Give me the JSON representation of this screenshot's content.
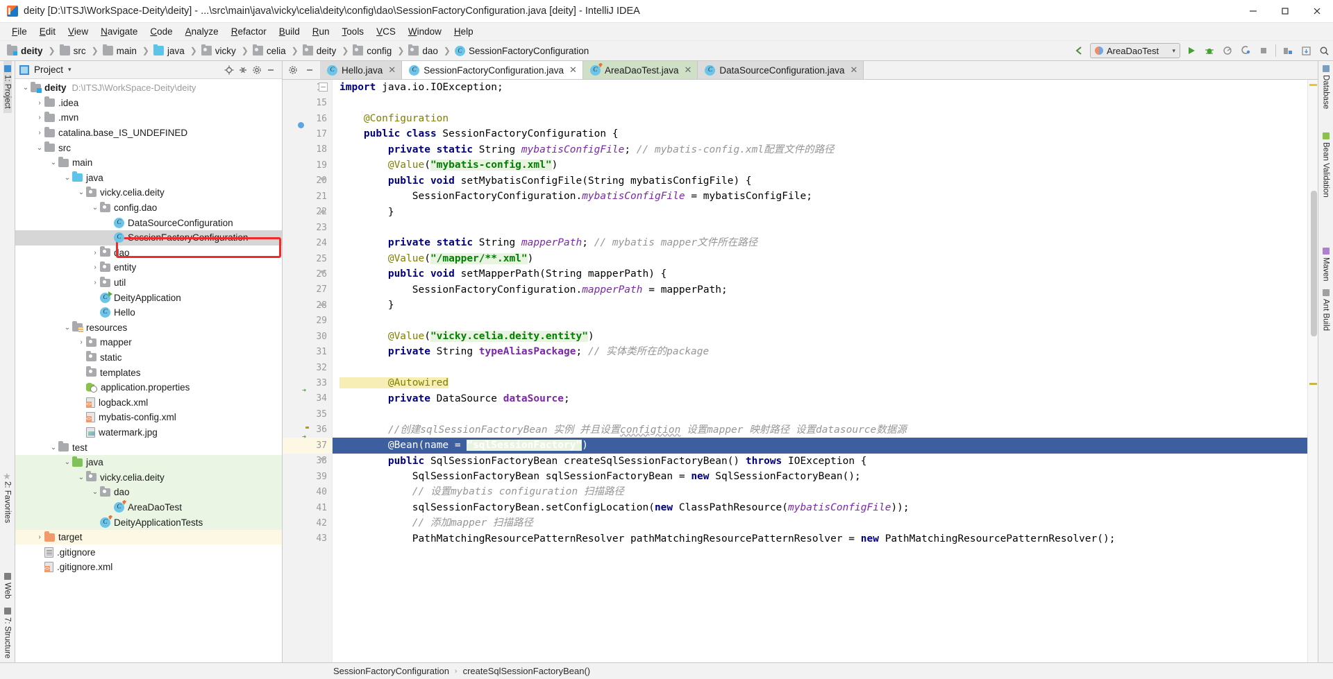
{
  "window": {
    "title": "deity [D:\\ITSJ\\WorkSpace-Deity\\deity] - ...\\src\\main\\java\\vicky\\celia\\deity\\config\\dao\\SessionFactoryConfiguration.java [deity] - IntelliJ IDEA",
    "minimize": "–",
    "maximize": "❐",
    "close": "✕"
  },
  "menubar": {
    "items": [
      "File",
      "Edit",
      "View",
      "Navigate",
      "Code",
      "Analyze",
      "Refactor",
      "Build",
      "Run",
      "Tools",
      "VCS",
      "Window",
      "Help"
    ]
  },
  "breadcrumb": [
    {
      "label": "deity",
      "icon": "module-folder-icon",
      "bold": true
    },
    {
      "label": "src",
      "icon": "folder-icon",
      "bold": false
    },
    {
      "label": "main",
      "icon": "folder-icon",
      "bold": false
    },
    {
      "label": "java",
      "icon": "source-folder-icon",
      "bold": false
    },
    {
      "label": "vicky",
      "icon": "package-icon",
      "bold": false
    },
    {
      "label": "celia",
      "icon": "package-icon",
      "bold": false
    },
    {
      "label": "deity",
      "icon": "package-icon",
      "bold": false
    },
    {
      "label": "config",
      "icon": "package-icon",
      "bold": false
    },
    {
      "label": "dao",
      "icon": "package-icon",
      "bold": false
    },
    {
      "label": "SessionFactoryConfiguration",
      "icon": "class-icon",
      "bold": false
    }
  ],
  "toolbar": {
    "back_arrow": "back-arrow-icon",
    "run_config": "AreaDaoTest",
    "run": "run-icon",
    "debug": "debug-icon",
    "coverage": "run-with-coverage-icon",
    "profile": "profiler-icon",
    "stop": "stop-icon",
    "project_structure": "project-structure-icon",
    "update": "update-icon",
    "search": "search-everywhere-icon"
  },
  "left_rail": [
    {
      "label": "1: Project",
      "icon": "project-icon",
      "selected": true
    },
    {
      "label": "2: Favorites",
      "icon": "star-icon",
      "selected": false
    },
    {
      "label": "Web",
      "icon": "web-icon",
      "selected": false
    },
    {
      "label": "7: Structure",
      "icon": "structure-icon",
      "selected": false
    }
  ],
  "right_rail": [
    {
      "label": "Database",
      "icon": "database-icon"
    },
    {
      "label": "Bean Validation",
      "icon": "bean-validation-icon"
    },
    {
      "label": "Maven",
      "icon": "maven-icon"
    },
    {
      "label": "Ant Build",
      "icon": "ant-build-icon"
    }
  ],
  "project_panel": {
    "title": "Project",
    "caret": "▾",
    "actions": [
      "locate-icon",
      "collapse-all-icon",
      "settings-icon",
      "hide-icon"
    ],
    "tree": [
      {
        "indent": 0,
        "arrow": "▾",
        "icon": "module-folder-icon",
        "name": "deity",
        "bold": true,
        "location": "D:\\ITSJ\\WorkSpace-Deity\\deity",
        "state": ""
      },
      {
        "indent": 1,
        "arrow": "›",
        "icon": "folder-icon",
        "name": ".idea",
        "bold": false,
        "location": "",
        "state": ""
      },
      {
        "indent": 1,
        "arrow": "›",
        "icon": "folder-icon",
        "name": ".mvn",
        "bold": false,
        "location": "",
        "state": ""
      },
      {
        "indent": 1,
        "arrow": "›",
        "icon": "folder-icon",
        "name": "catalina.base_IS_UNDEFINED",
        "bold": false,
        "location": "",
        "state": ""
      },
      {
        "indent": 1,
        "arrow": "▾",
        "icon": "folder-icon",
        "name": "src",
        "bold": false,
        "location": "",
        "state": ""
      },
      {
        "indent": 2,
        "arrow": "▾",
        "icon": "folder-icon",
        "name": "main",
        "bold": false,
        "location": "",
        "state": ""
      },
      {
        "indent": 3,
        "arrow": "▾",
        "icon": "source-folder-icon",
        "name": "java",
        "bold": false,
        "location": "",
        "state": ""
      },
      {
        "indent": 4,
        "arrow": "▾",
        "icon": "package-icon",
        "name": "vicky.celia.deity",
        "bold": false,
        "location": "",
        "state": ""
      },
      {
        "indent": 5,
        "arrow": "▾",
        "icon": "package-icon",
        "name": "config.dao",
        "bold": false,
        "location": "",
        "state": ""
      },
      {
        "indent": 6,
        "arrow": "",
        "icon": "class-icon",
        "name": "DataSourceConfiguration",
        "bold": false,
        "location": "",
        "state": ""
      },
      {
        "indent": 6,
        "arrow": "",
        "icon": "class-icon",
        "name": "SessionFactoryConfiguration",
        "bold": false,
        "location": "",
        "state": "selected"
      },
      {
        "indent": 5,
        "arrow": "›",
        "icon": "package-icon",
        "name": "dao",
        "bold": false,
        "location": "",
        "state": ""
      },
      {
        "indent": 5,
        "arrow": "›",
        "icon": "package-icon",
        "name": "entity",
        "bold": false,
        "location": "",
        "state": ""
      },
      {
        "indent": 5,
        "arrow": "›",
        "icon": "package-icon",
        "name": "util",
        "bold": false,
        "location": "",
        "state": ""
      },
      {
        "indent": 5,
        "arrow": "",
        "icon": "runnable-class-icon",
        "name": "DeityApplication",
        "bold": false,
        "location": "",
        "state": ""
      },
      {
        "indent": 5,
        "arrow": "",
        "icon": "class-icon",
        "name": "Hello",
        "bold": false,
        "location": "",
        "state": ""
      },
      {
        "indent": 3,
        "arrow": "▾",
        "icon": "resources-folder-icon",
        "name": "resources",
        "bold": false,
        "location": "",
        "state": ""
      },
      {
        "indent": 4,
        "arrow": "›",
        "icon": "package-icon",
        "name": "mapper",
        "bold": false,
        "location": "",
        "state": ""
      },
      {
        "indent": 4,
        "arrow": "",
        "icon": "package-icon",
        "name": "static",
        "bold": false,
        "location": "",
        "state": ""
      },
      {
        "indent": 4,
        "arrow": "",
        "icon": "package-icon",
        "name": "templates",
        "bold": false,
        "location": "",
        "state": ""
      },
      {
        "indent": 4,
        "arrow": "",
        "icon": "properties-icon",
        "name": "application.properties",
        "bold": false,
        "location": "",
        "state": ""
      },
      {
        "indent": 4,
        "arrow": "",
        "icon": "xml-file-icon",
        "name": "logback.xml",
        "bold": false,
        "location": "",
        "state": ""
      },
      {
        "indent": 4,
        "arrow": "",
        "icon": "xml-file-icon",
        "name": "mybatis-config.xml",
        "bold": false,
        "location": "",
        "state": ""
      },
      {
        "indent": 4,
        "arrow": "",
        "icon": "image-file-icon",
        "name": "watermark.jpg",
        "bold": false,
        "location": "",
        "state": ""
      },
      {
        "indent": 2,
        "arrow": "▾",
        "icon": "folder-icon",
        "name": "test",
        "bold": false,
        "location": "",
        "state": ""
      },
      {
        "indent": 3,
        "arrow": "▾",
        "icon": "test-source-folder-icon",
        "name": "java",
        "bold": false,
        "location": "",
        "state": "green"
      },
      {
        "indent": 4,
        "arrow": "▾",
        "icon": "package-icon",
        "name": "vicky.celia.deity",
        "bold": false,
        "location": "",
        "state": "green"
      },
      {
        "indent": 5,
        "arrow": "▾",
        "icon": "package-icon",
        "name": "dao",
        "bold": false,
        "location": "",
        "state": "green"
      },
      {
        "indent": 6,
        "arrow": "",
        "icon": "test-class-icon",
        "name": "AreaDaoTest",
        "bold": false,
        "location": "",
        "state": "green"
      },
      {
        "indent": 5,
        "arrow": "",
        "icon": "test-class-icon",
        "name": "DeityApplicationTests",
        "bold": false,
        "location": "",
        "state": "green"
      },
      {
        "indent": 1,
        "arrow": "›",
        "icon": "target-folder-icon",
        "name": "target",
        "bold": false,
        "location": "",
        "state": "yellow"
      },
      {
        "indent": 1,
        "arrow": "",
        "icon": "gitignore-file-icon",
        "name": ".gitignore",
        "bold": false,
        "location": "",
        "state": ""
      },
      {
        "indent": 1,
        "arrow": "",
        "icon": "xml-file-icon",
        "name": ".gitignore.xml",
        "bold": false,
        "location": "",
        "state": ""
      }
    ],
    "highlight_note": "red-annotation-box-around-SessionFactoryConfiguration"
  },
  "editor_tabs": [
    {
      "label": "Hello.java",
      "icon": "class-icon",
      "state": "inactive",
      "close": "✕"
    },
    {
      "label": "SessionFactoryConfiguration.java",
      "icon": "class-icon",
      "state": "active",
      "close": "✕"
    },
    {
      "label": "AreaDaoTest.java",
      "icon": "test-class-icon",
      "state": "test",
      "close": "✕"
    },
    {
      "label": "DataSourceConfiguration.java",
      "icon": "class-icon",
      "state": "inactive",
      "close": "✕"
    }
  ],
  "code": {
    "first_line": 14,
    "current_line": 37,
    "lines": [
      {
        "n": 14,
        "mark": "",
        "fold": "minus",
        "tokens": [
          {
            "t": "import",
            "c": "k"
          },
          {
            "t": " java.io.IOException;",
            "c": "plain"
          }
        ]
      },
      {
        "n": 15,
        "mark": "",
        "fold": "",
        "tokens": []
      },
      {
        "n": 16,
        "mark": "",
        "fold": "",
        "tokens": [
          {
            "t": "    @Configuration",
            "c": "ann"
          }
        ]
      },
      {
        "n": 17,
        "mark": "bean",
        "fold": "",
        "tokens": [
          {
            "t": "    public class",
            "c": "k"
          },
          {
            "t": " SessionFactoryConfiguration {",
            "c": "plain"
          }
        ]
      },
      {
        "n": 18,
        "mark": "",
        "fold": "",
        "tokens": [
          {
            "t": "        private static",
            "c": "k"
          },
          {
            "t": " String ",
            "c": "plain"
          },
          {
            "t": "mybatisConfigFile",
            "c": "fld"
          },
          {
            "t": "; ",
            "c": "plain"
          },
          {
            "t": "// mybatis-config.xml配置文件的路径",
            "c": "cmt"
          }
        ]
      },
      {
        "n": 19,
        "mark": "",
        "fold": "",
        "tokens": [
          {
            "t": "        @Value",
            "c": "ann"
          },
          {
            "t": "(",
            "c": "plain"
          },
          {
            "t": "\"mybatis-config.xml\"",
            "c": "str"
          },
          {
            "t": ")",
            "c": "plain"
          }
        ]
      },
      {
        "n": 20,
        "mark": "",
        "fold": "tri-down",
        "tokens": [
          {
            "t": "        public void",
            "c": "k"
          },
          {
            "t": " setMybatisConfigFile(String mybatisConfigFile) {",
            "c": "plain"
          }
        ]
      },
      {
        "n": 21,
        "mark": "",
        "fold": "",
        "tokens": [
          {
            "t": "            SessionFactoryConfiguration.",
            "c": "plain"
          },
          {
            "t": "mybatisConfigFile",
            "c": "fld"
          },
          {
            "t": " = mybatisConfigFile;",
            "c": "plain"
          }
        ]
      },
      {
        "n": 22,
        "mark": "",
        "fold": "tri-up",
        "tokens": [
          {
            "t": "        }",
            "c": "plain"
          }
        ]
      },
      {
        "n": 23,
        "mark": "",
        "fold": "",
        "tokens": []
      },
      {
        "n": 24,
        "mark": "",
        "fold": "",
        "tokens": [
          {
            "t": "        private static",
            "c": "k"
          },
          {
            "t": " String ",
            "c": "plain"
          },
          {
            "t": "mapperPath",
            "c": "fld"
          },
          {
            "t": "; ",
            "c": "plain"
          },
          {
            "t": "// mybatis mapper文件所在路径",
            "c": "cmt"
          }
        ]
      },
      {
        "n": 25,
        "mark": "",
        "fold": "",
        "tokens": [
          {
            "t": "        @Value",
            "c": "ann"
          },
          {
            "t": "(",
            "c": "plain"
          },
          {
            "t": "\"/mapper/**.xml\"",
            "c": "str"
          },
          {
            "t": ")",
            "c": "plain"
          }
        ]
      },
      {
        "n": 26,
        "mark": "",
        "fold": "tri-down",
        "tokens": [
          {
            "t": "        public void",
            "c": "k"
          },
          {
            "t": " setMapperPath(String mapperPath) {",
            "c": "plain"
          }
        ]
      },
      {
        "n": 27,
        "mark": "",
        "fold": "",
        "tokens": [
          {
            "t": "            SessionFactoryConfiguration.",
            "c": "plain"
          },
          {
            "t": "mapperPath",
            "c": "fld"
          },
          {
            "t": " = mapperPath;",
            "c": "plain"
          }
        ]
      },
      {
        "n": 28,
        "mark": "",
        "fold": "tri-up",
        "tokens": [
          {
            "t": "        }",
            "c": "plain"
          }
        ]
      },
      {
        "n": 29,
        "mark": "",
        "fold": "",
        "tokens": []
      },
      {
        "n": 30,
        "mark": "",
        "fold": "",
        "tokens": [
          {
            "t": "        @Value",
            "c": "ann"
          },
          {
            "t": "(",
            "c": "plain"
          },
          {
            "t": "\"vicky.celia.deity.entity\"",
            "c": "str"
          },
          {
            "t": ")",
            "c": "plain"
          }
        ]
      },
      {
        "n": 31,
        "mark": "",
        "fold": "",
        "tokens": [
          {
            "t": "        private",
            "c": "k"
          },
          {
            "t": " String ",
            "c": "plain"
          },
          {
            "t": "typeAliasPackage",
            "c": "fld-b"
          },
          {
            "t": "; ",
            "c": "plain"
          },
          {
            "t": "// 实体类所在的package",
            "c": "cmt"
          }
        ]
      },
      {
        "n": 32,
        "mark": "",
        "fold": "",
        "tokens": []
      },
      {
        "n": 33,
        "mark": "",
        "fold": "",
        "tokens": [
          {
            "t": "        @Autowired",
            "c": "ann hl-yellow"
          }
        ]
      },
      {
        "n": 34,
        "mark": "bean-arrow",
        "fold": "",
        "tokens": [
          {
            "t": "        private",
            "c": "k"
          },
          {
            "t": " DataSource ",
            "c": "plain"
          },
          {
            "t": "dataSource",
            "c": "fld-b"
          },
          {
            "t": ";",
            "c": "plain"
          }
        ]
      },
      {
        "n": 35,
        "mark": "",
        "fold": "",
        "tokens": []
      },
      {
        "n": 36,
        "mark": "bulb",
        "fold": "",
        "tokens": [
          {
            "t": "        //创建sqlSessionFactoryBean 实例 并且设置",
            "c": "cmt"
          },
          {
            "t": "configtion",
            "c": "cmt squiggle"
          },
          {
            "t": " 设置mapper 映射路径 设置datasource数据源",
            "c": "cmt"
          }
        ]
      },
      {
        "n": 37,
        "mark": "bean-arrow",
        "fold": "",
        "selected": true,
        "tokens": [
          {
            "t": "        @Bean",
            "c": "ann"
          },
          {
            "t": "(name = ",
            "c": "plain"
          },
          {
            "t": "\"sqlSessionFactory\"",
            "c": "str"
          },
          {
            "t": ")",
            "c": "plain"
          }
        ]
      },
      {
        "n": 38,
        "mark": "",
        "fold": "tri-down",
        "tokens": [
          {
            "t": "        public",
            "c": "k"
          },
          {
            "t": " SqlSessionFactoryBean createSqlSessionFactoryBean() ",
            "c": "plain"
          },
          {
            "t": "throws",
            "c": "k"
          },
          {
            "t": " IOException {",
            "c": "plain"
          }
        ]
      },
      {
        "n": 39,
        "mark": "",
        "fold": "",
        "tokens": [
          {
            "t": "            SqlSessionFactoryBean sqlSessionFactoryBean = ",
            "c": "plain"
          },
          {
            "t": "new",
            "c": "k"
          },
          {
            "t": " SqlSessionFactoryBean();",
            "c": "plain"
          }
        ]
      },
      {
        "n": 40,
        "mark": "",
        "fold": "",
        "tokens": [
          {
            "t": "            // 设置mybatis configuration 扫描路径",
            "c": "cmt"
          }
        ]
      },
      {
        "n": 41,
        "mark": "",
        "fold": "",
        "tokens": [
          {
            "t": "            sqlSessionFactoryBean.setConfigLocation(",
            "c": "plain"
          },
          {
            "t": "new",
            "c": "k"
          },
          {
            "t": " ClassPathResource(",
            "c": "plain"
          },
          {
            "t": "mybatisConfigFile",
            "c": "fld"
          },
          {
            "t": "));",
            "c": "plain"
          }
        ]
      },
      {
        "n": 42,
        "mark": "",
        "fold": "",
        "tokens": [
          {
            "t": "            // 添加mapper 扫描路径",
            "c": "cmt"
          }
        ]
      },
      {
        "n": 43,
        "mark": "",
        "fold": "",
        "tokens": [
          {
            "t": "            PathMatchingResourcePatternResolver pathMatchingResourcePatternResolver = ",
            "c": "plain"
          },
          {
            "t": "new",
            "c": "k"
          },
          {
            "t": " PathMatchingResourcePatternResolver();",
            "c": "plain"
          }
        ]
      }
    ]
  },
  "statusbar": {
    "crumb_class": "SessionFactoryConfiguration",
    "separator": "›",
    "crumb_method": "createSqlSessionFactoryBean()"
  }
}
